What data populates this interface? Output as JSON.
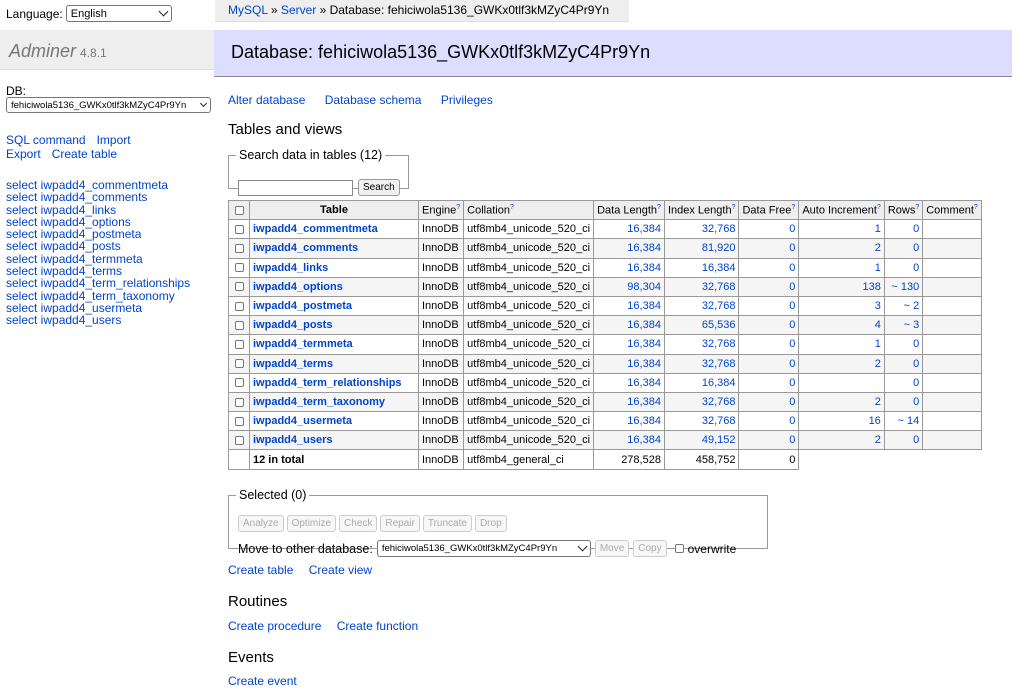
{
  "language": {
    "label": "Language:",
    "value": "English"
  },
  "app": {
    "name": "Adminer",
    "version": "4.8.1"
  },
  "db": {
    "label": "DB:",
    "value": "fehiciwola5136_GWKx0tlf3kMZyC4Pr9Yn"
  },
  "menu_links": {
    "sql": "SQL command",
    "import": "Import",
    "export": "Export",
    "create_table": "Create table"
  },
  "table_links": [
    "select iwpadd4_commentmeta",
    "select iwpadd4_comments",
    "select iwpadd4_links",
    "select iwpadd4_options",
    "select iwpadd4_postmeta",
    "select iwpadd4_posts",
    "select iwpadd4_termmeta",
    "select iwpadd4_terms",
    "select iwpadd4_term_relationships",
    "select iwpadd4_term_taxonomy",
    "select iwpadd4_usermeta",
    "select iwpadd4_users"
  ],
  "breadcrumb": {
    "mysql": "MySQL",
    "sep": " » ",
    "server": "Server",
    "current": "Database: fehiciwola5136_GWKx0tlf3kMZyC4Pr9Yn"
  },
  "page_title": "Database: fehiciwola5136_GWKx0tlf3kMZyC4Pr9Yn",
  "top_links": {
    "alter": "Alter database",
    "schema": "Database schema",
    "privileges": "Privileges"
  },
  "tables_heading": "Tables and views",
  "search": {
    "legend": "Search data in tables (12)",
    "button": "Search"
  },
  "help_mark": "?",
  "columns": {
    "table": "Table",
    "engine": "Engine",
    "collation": "Collation",
    "data_length": "Data Length",
    "index_length": "Index Length",
    "data_free": "Data Free",
    "auto_increment": "Auto Increment",
    "rows": "Rows",
    "comment": "Comment"
  },
  "rows": [
    {
      "name": "iwpadd4_commentmeta",
      "engine": "InnoDB",
      "collation": "utf8mb4_unicode_520_ci",
      "data": "16,384",
      "index": "32,768",
      "free": "0",
      "ai": "1",
      "rows": "0"
    },
    {
      "name": "iwpadd4_comments",
      "engine": "InnoDB",
      "collation": "utf8mb4_unicode_520_ci",
      "data": "16,384",
      "index": "81,920",
      "free": "0",
      "ai": "2",
      "rows": "0"
    },
    {
      "name": "iwpadd4_links",
      "engine": "InnoDB",
      "collation": "utf8mb4_unicode_520_ci",
      "data": "16,384",
      "index": "16,384",
      "free": "0",
      "ai": "1",
      "rows": "0"
    },
    {
      "name": "iwpadd4_options",
      "engine": "InnoDB",
      "collation": "utf8mb4_unicode_520_ci",
      "data": "98,304",
      "index": "32,768",
      "free": "0",
      "ai": "138",
      "rows": "~ 130"
    },
    {
      "name": "iwpadd4_postmeta",
      "engine": "InnoDB",
      "collation": "utf8mb4_unicode_520_ci",
      "data": "16,384",
      "index": "32,768",
      "free": "0",
      "ai": "3",
      "rows": "~ 2"
    },
    {
      "name": "iwpadd4_posts",
      "engine": "InnoDB",
      "collation": "utf8mb4_unicode_520_ci",
      "data": "16,384",
      "index": "65,536",
      "free": "0",
      "ai": "4",
      "rows": "~ 3"
    },
    {
      "name": "iwpadd4_termmeta",
      "engine": "InnoDB",
      "collation": "utf8mb4_unicode_520_ci",
      "data": "16,384",
      "index": "32,768",
      "free": "0",
      "ai": "1",
      "rows": "0"
    },
    {
      "name": "iwpadd4_terms",
      "engine": "InnoDB",
      "collation": "utf8mb4_unicode_520_ci",
      "data": "16,384",
      "index": "32,768",
      "free": "0",
      "ai": "2",
      "rows": "0"
    },
    {
      "name": "iwpadd4_term_relationships",
      "engine": "InnoDB",
      "collation": "utf8mb4_unicode_520_ci",
      "data": "16,384",
      "index": "16,384",
      "free": "0",
      "ai": "",
      "rows": "0"
    },
    {
      "name": "iwpadd4_term_taxonomy",
      "engine": "InnoDB",
      "collation": "utf8mb4_unicode_520_ci",
      "data": "16,384",
      "index": "32,768",
      "free": "0",
      "ai": "2",
      "rows": "0"
    },
    {
      "name": "iwpadd4_usermeta",
      "engine": "InnoDB",
      "collation": "utf8mb4_unicode_520_ci",
      "data": "16,384",
      "index": "32,768",
      "free": "0",
      "ai": "16",
      "rows": "~ 14"
    },
    {
      "name": "iwpadd4_users",
      "engine": "InnoDB",
      "collation": "utf8mb4_unicode_520_ci",
      "data": "16,384",
      "index": "49,152",
      "free": "0",
      "ai": "2",
      "rows": "0"
    }
  ],
  "total": {
    "label": "12 in total",
    "engine": "InnoDB",
    "collation": "utf8mb4_general_ci",
    "data": "278,528",
    "index": "458,752",
    "free": "0"
  },
  "selected": {
    "legend": "Selected (0)",
    "analyze": "Analyze",
    "optimize": "Optimize",
    "check": "Check",
    "repair": "Repair",
    "truncate": "Truncate",
    "drop": "Drop",
    "move_label": "Move to other database:",
    "move_target": "fehiciwola5136_GWKx0tlf3kMZyC4Pr9Yn",
    "move": "Move",
    "copy": "Copy",
    "overwrite": "overwrite"
  },
  "create_links": {
    "table": "Create table",
    "view": "Create view"
  },
  "routines": {
    "heading": "Routines",
    "procedure": "Create procedure",
    "function": "Create function"
  },
  "events": {
    "heading": "Events",
    "create": "Create event"
  },
  "colors": {
    "link": "#0044cc",
    "header_bg": "#ddddff",
    "sidebar_bg": "#eeeeee"
  }
}
